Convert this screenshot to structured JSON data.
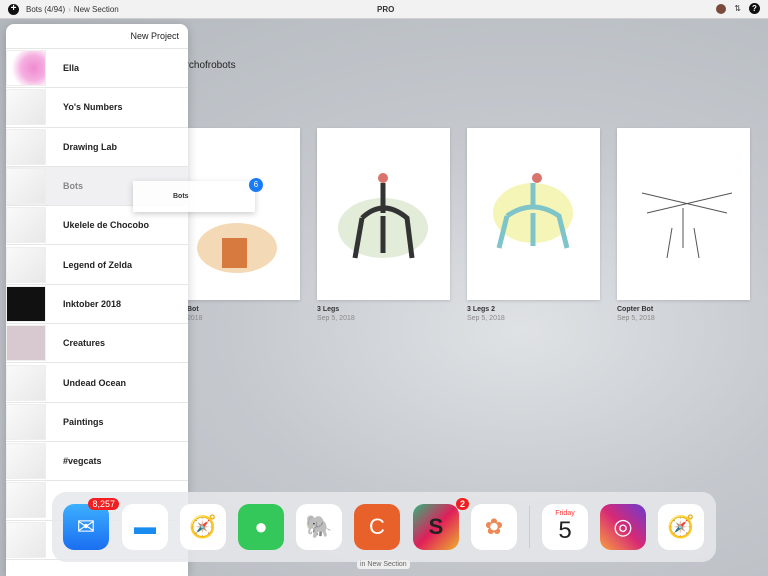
{
  "topbar": {
    "breadcrumb": "Bots (4/94)",
    "section": "New Section",
    "app_badge": "PRO"
  },
  "panel": {
    "new_project": "New Project",
    "items": [
      {
        "label": "Ella"
      },
      {
        "label": "Yo's Numbers"
      },
      {
        "label": "Drawing Lab"
      },
      {
        "label": "Bots"
      },
      {
        "label": "Ukelele de Chocobo"
      },
      {
        "label": "Legend of Zelda"
      },
      {
        "label": "Inktober 2018"
      },
      {
        "label": "Creatures"
      },
      {
        "label": "Undead Ocean"
      },
      {
        "label": "Paintings"
      },
      {
        "label": "#vegcats"
      },
      {
        "label": ""
      },
      {
        "label": ""
      }
    ]
  },
  "gallery": {
    "title": "archofrobots",
    "cards": [
      {
        "name": "Bot",
        "date": "2018"
      },
      {
        "name": "3 Legs",
        "date": "Sep 5, 2018"
      },
      {
        "name": "3 Legs 2",
        "date": "Sep 5, 2018"
      },
      {
        "name": "Copter Bot",
        "date": "Sep 5, 2018"
      }
    ]
  },
  "drag": {
    "label": "Bots",
    "count": "6"
  },
  "dock": {
    "mail_badge": "8,257",
    "slack_badge": "2",
    "calendar_day": "Friday",
    "calendar_date": "5"
  },
  "bottom_label": "in New Section"
}
